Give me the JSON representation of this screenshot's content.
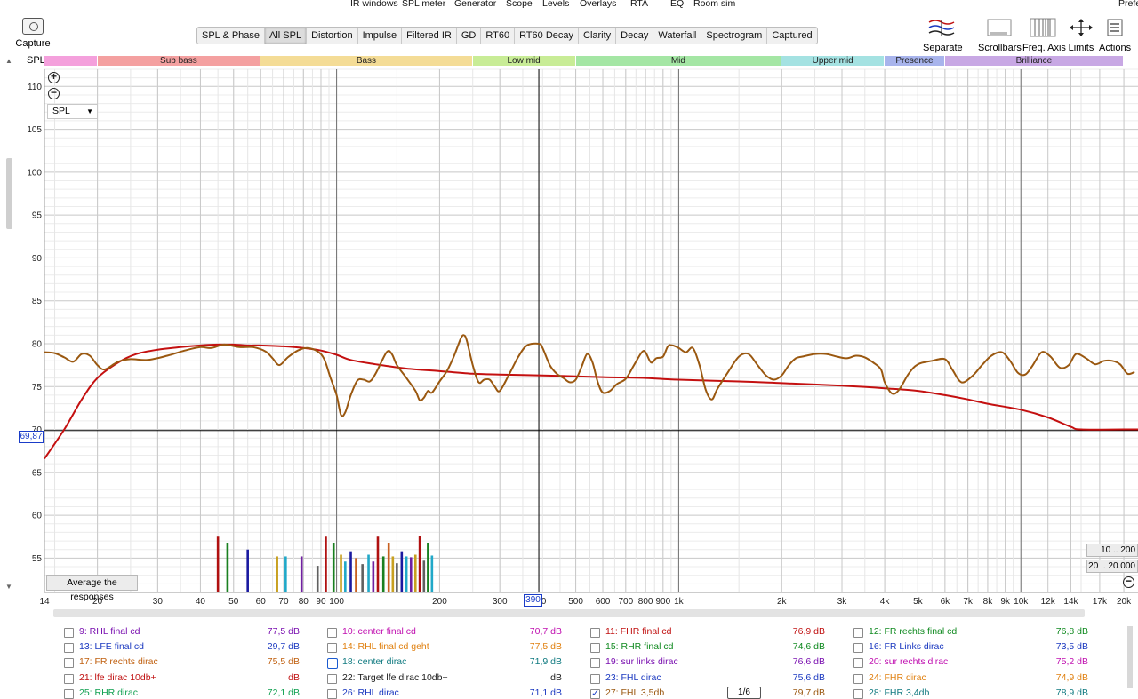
{
  "menu": [
    "IR windows",
    "SPL meter",
    "Generator",
    "Scope",
    "Levels",
    "Overlays",
    "RTA",
    "EQ",
    "Room sim",
    "Prefe"
  ],
  "capture_label": "Capture",
  "tabs": [
    "SPL & Phase",
    "All SPL",
    "Distortion",
    "Impulse",
    "Filtered IR",
    "GD",
    "RT60",
    "RT60 Decay",
    "Clarity",
    "Decay",
    "Waterfall",
    "Spectrogram",
    "Captured"
  ],
  "active_tab": "All SPL",
  "tools": [
    "Separate",
    "Scrollbars",
    "Freq. Axis",
    "Limits",
    "Actions"
  ],
  "plot_header": "SPL",
  "bands": [
    {
      "label": "",
      "color": "#f4a0dc",
      "f1": 14,
      "f2": 20
    },
    {
      "label": "Sub bass",
      "color": "#f4a0a0",
      "f1": 20,
      "f2": 60
    },
    {
      "label": "Bass",
      "color": "#f4dc96",
      "f1": 60,
      "f2": 250
    },
    {
      "label": "Low mid",
      "color": "#c8ec96",
      "f1": 250,
      "f2": 500
    },
    {
      "label": "Mid",
      "color": "#a4e6a4",
      "f1": 500,
      "f2": 2000
    },
    {
      "label": "Upper mid",
      "color": "#a4e2e2",
      "f1": 2000,
      "f2": 4000
    },
    {
      "label": "Presence",
      "color": "#a8b4ec",
      "f1": 4000,
      "f2": 6000
    },
    {
      "label": "Brilliance",
      "color": "#c8a8e4",
      "f1": 6000,
      "f2": 20000
    }
  ],
  "y_select": "SPL",
  "cursor_y": "69,87",
  "cursor_x": "390",
  "avg_button": "Average the responses",
  "range_buttons": [
    "10 .. 200",
    "20 .. 20.000"
  ],
  "chart_data": {
    "type": "line",
    "xscale": "log",
    "xlim": [
      14,
      22000
    ],
    "ylim": [
      51,
      112
    ],
    "yticks": [
      55,
      60,
      65,
      70,
      75,
      80,
      85,
      90,
      95,
      100,
      105,
      110
    ],
    "xticks": [
      {
        "f": 14,
        "label": "14"
      },
      {
        "f": 20,
        "label": "20"
      },
      {
        "f": 30,
        "label": "30"
      },
      {
        "f": 40,
        "label": "40"
      },
      {
        "f": 50,
        "label": "50"
      },
      {
        "f": 60,
        "label": "60"
      },
      {
        "f": 70,
        "label": "70"
      },
      {
        "f": 80,
        "label": "80"
      },
      {
        "f": 90,
        "label": "90"
      },
      {
        "f": 100,
        "label": "100"
      },
      {
        "f": 200,
        "label": "200"
      },
      {
        "f": 300,
        "label": "300"
      },
      {
        "f": 390,
        "label": "390"
      },
      {
        "f": 500,
        "label": "500"
      },
      {
        "f": 600,
        "label": "600"
      },
      {
        "f": 700,
        "label": "700"
      },
      {
        "f": 800,
        "label": "800"
      },
      {
        "f": 900,
        "label": "900"
      },
      {
        "f": 1000,
        "label": "1k"
      },
      {
        "f": 2000,
        "label": "2k"
      },
      {
        "f": 3000,
        "label": "3k"
      },
      {
        "f": 4000,
        "label": "4k"
      },
      {
        "f": 5000,
        "label": "5k"
      },
      {
        "f": 6000,
        "label": "6k"
      },
      {
        "f": 7000,
        "label": "7k"
      },
      {
        "f": 8000,
        "label": "8k"
      },
      {
        "f": 9000,
        "label": "9k"
      },
      {
        "f": 10000,
        "label": "10k"
      },
      {
        "f": 12000,
        "label": "12k"
      },
      {
        "f": 14000,
        "label": "14k"
      },
      {
        "f": 17000,
        "label": "17k"
      },
      {
        "f": 20000,
        "label": "20k"
      }
    ],
    "series": [
      {
        "color": "#c41010",
        "points": [
          [
            14,
            66.6
          ],
          [
            16,
            70
          ],
          [
            18,
            73.5
          ],
          [
            20,
            76
          ],
          [
            23,
            77.8
          ],
          [
            26,
            78.8
          ],
          [
            30,
            79.3
          ],
          [
            35,
            79.6
          ],
          [
            40,
            79.8
          ],
          [
            45,
            79.9
          ],
          [
            50,
            79.9
          ],
          [
            55,
            79.8
          ],
          [
            60,
            79.8
          ],
          [
            70,
            79.7
          ],
          [
            80,
            79.5
          ],
          [
            90,
            79.2
          ],
          [
            100,
            78.7
          ],
          [
            110,
            78.1
          ],
          [
            130,
            77.6
          ],
          [
            160,
            77.1
          ],
          [
            200,
            76.8
          ],
          [
            250,
            76.5
          ],
          [
            300,
            76.4
          ],
          [
            400,
            76.3
          ],
          [
            500,
            76.2
          ],
          [
            600,
            76.1
          ],
          [
            800,
            76
          ],
          [
            1000,
            75.8
          ],
          [
            1500,
            75.6
          ],
          [
            2000,
            75.4
          ],
          [
            3000,
            75.1
          ],
          [
            4000,
            74.8
          ],
          [
            5000,
            74.5
          ],
          [
            6000,
            74
          ],
          [
            7000,
            73.5
          ],
          [
            8000,
            73
          ],
          [
            10000,
            72.3
          ],
          [
            12000,
            71.4
          ],
          [
            14000,
            70.3
          ],
          [
            15000,
            70
          ],
          [
            20000,
            70
          ],
          [
            22000,
            70
          ]
        ]
      },
      {
        "color": "#9a5810",
        "points": [
          [
            14,
            79
          ],
          [
            15,
            78.9
          ],
          [
            16,
            78.4
          ],
          [
            17,
            77.9
          ],
          [
            18,
            78.8
          ],
          [
            19,
            78.6
          ],
          [
            20,
            77.5
          ],
          [
            21,
            77
          ],
          [
            23,
            77.9
          ],
          [
            25,
            78.2
          ],
          [
            28,
            78.1
          ],
          [
            32,
            78.6
          ],
          [
            36,
            79.2
          ],
          [
            40,
            79.6
          ],
          [
            43,
            79.5
          ],
          [
            47,
            79.9
          ],
          [
            52,
            79.6
          ],
          [
            57,
            79.6
          ],
          [
            62,
            79.1
          ],
          [
            65,
            78.3
          ],
          [
            68,
            77.5
          ],
          [
            72,
            78.4
          ],
          [
            77,
            79.2
          ],
          [
            82,
            79.5
          ],
          [
            88,
            79.1
          ],
          [
            92,
            78.2
          ],
          [
            96,
            76
          ],
          [
            100,
            74
          ],
          [
            103,
            71.7
          ],
          [
            106,
            72
          ],
          [
            110,
            74
          ],
          [
            115,
            75.7
          ],
          [
            120,
            75.8
          ],
          [
            125,
            75.6
          ],
          [
            130,
            76.5
          ],
          [
            140,
            79
          ],
          [
            145,
            78.8
          ],
          [
            150,
            77.5
          ],
          [
            160,
            76
          ],
          [
            170,
            74.5
          ],
          [
            175,
            73.4
          ],
          [
            180,
            73.7
          ],
          [
            185,
            74.5
          ],
          [
            190,
            74.3
          ],
          [
            200,
            75.6
          ],
          [
            210,
            76.8
          ],
          [
            220,
            78.5
          ],
          [
            230,
            80.5
          ],
          [
            235,
            81
          ],
          [
            240,
            80.4
          ],
          [
            250,
            77.5
          ],
          [
            260,
            75.5
          ],
          [
            270,
            75.8
          ],
          [
            280,
            75.8
          ],
          [
            290,
            75
          ],
          [
            300,
            74.5
          ],
          [
            320,
            76.5
          ],
          [
            340,
            78.5
          ],
          [
            360,
            79.8
          ],
          [
            390,
            80
          ],
          [
            400,
            79.5
          ],
          [
            420,
            77.5
          ],
          [
            440,
            76.5
          ],
          [
            460,
            76
          ],
          [
            480,
            75.5
          ],
          [
            500,
            75.8
          ],
          [
            520,
            77.3
          ],
          [
            540,
            78.8
          ],
          [
            560,
            77.8
          ],
          [
            580,
            75.5
          ],
          [
            600,
            74.3
          ],
          [
            630,
            74.5
          ],
          [
            660,
            75.3
          ],
          [
            700,
            75.9
          ],
          [
            740,
            77.5
          ],
          [
            780,
            79
          ],
          [
            800,
            79
          ],
          [
            830,
            77.8
          ],
          [
            860,
            78.3
          ],
          [
            900,
            78.5
          ],
          [
            930,
            79.7
          ],
          [
            960,
            79.8
          ],
          [
            1000,
            79.5
          ],
          [
            1050,
            79
          ],
          [
            1100,
            79.5
          ],
          [
            1150,
            77.5
          ],
          [
            1200,
            74.6
          ],
          [
            1250,
            73.5
          ],
          [
            1300,
            74.8
          ],
          [
            1400,
            76.8
          ],
          [
            1500,
            78.5
          ],
          [
            1600,
            78.8
          ],
          [
            1700,
            77.5
          ],
          [
            1800,
            76.3
          ],
          [
            1900,
            75.8
          ],
          [
            2000,
            76.3
          ],
          [
            2100,
            77.5
          ],
          [
            2200,
            78.3
          ],
          [
            2300,
            78.5
          ],
          [
            2500,
            78.8
          ],
          [
            2700,
            78.8
          ],
          [
            2900,
            78.5
          ],
          [
            3100,
            78.3
          ],
          [
            3300,
            78.6
          ],
          [
            3500,
            78.4
          ],
          [
            3700,
            77.8
          ],
          [
            3900,
            77
          ],
          [
            4000,
            75.5
          ],
          [
            4200,
            74.2
          ],
          [
            4400,
            74.6
          ],
          [
            4700,
            76.5
          ],
          [
            5000,
            77.6
          ],
          [
            5500,
            78
          ],
          [
            6000,
            78.2
          ],
          [
            6300,
            77
          ],
          [
            6700,
            75.5
          ],
          [
            7200,
            76.2
          ],
          [
            7700,
            77.5
          ],
          [
            8200,
            78.6
          ],
          [
            8800,
            79
          ],
          [
            9300,
            78
          ],
          [
            9800,
            76.6
          ],
          [
            10300,
            76.4
          ],
          [
            10800,
            77.4
          ],
          [
            11500,
            79
          ],
          [
            12200,
            78.5
          ],
          [
            13000,
            77.2
          ],
          [
            13800,
            77.5
          ],
          [
            14500,
            78.8
          ],
          [
            15500,
            78.3
          ],
          [
            16500,
            77.6
          ],
          [
            17500,
            78
          ],
          [
            18500,
            78
          ],
          [
            19500,
            77.6
          ],
          [
            20500,
            76.5
          ],
          [
            21500,
            76.7
          ]
        ]
      }
    ],
    "bars": [
      {
        "f": 45,
        "v": 57.5,
        "color": "#b01010"
      },
      {
        "f": 48,
        "v": 56.8,
        "color": "#1a8020"
      },
      {
        "f": 55,
        "v": 56,
        "color": "#1a1aa0"
      },
      {
        "f": 67,
        "v": 55.2,
        "color": "#c8a020"
      },
      {
        "f": 71,
        "v": 55.2,
        "color": "#20a8c8"
      },
      {
        "f": 79,
        "v": 55.2,
        "color": "#7020a0"
      },
      {
        "f": 88,
        "v": 54.1,
        "color": "#606060"
      },
      {
        "f": 93,
        "v": 57.5,
        "color": "#b01010"
      },
      {
        "f": 98,
        "v": 56.8,
        "color": "#1a8020"
      },
      {
        "f": 103,
        "v": 55.4,
        "color": "#c8a020"
      },
      {
        "f": 106,
        "v": 54.6,
        "color": "#20a8c8"
      },
      {
        "f": 110,
        "v": 55.8,
        "color": "#1a1aa0"
      },
      {
        "f": 114,
        "v": 55,
        "color": "#c86020"
      },
      {
        "f": 119,
        "v": 54.3,
        "color": "#606060"
      },
      {
        "f": 124,
        "v": 55.4,
        "color": "#20a8c8"
      },
      {
        "f": 128,
        "v": 54.6,
        "color": "#7020a0"
      },
      {
        "f": 132,
        "v": 57.5,
        "color": "#b01010"
      },
      {
        "f": 137,
        "v": 55.2,
        "color": "#1a8020"
      },
      {
        "f": 142,
        "v": 56.8,
        "color": "#c86020"
      },
      {
        "f": 146,
        "v": 55.2,
        "color": "#c8a020"
      },
      {
        "f": 150,
        "v": 54.4,
        "color": "#606060"
      },
      {
        "f": 155,
        "v": 55.8,
        "color": "#1a1aa0"
      },
      {
        "f": 160,
        "v": 55.2,
        "color": "#20a8c8"
      },
      {
        "f": 165,
        "v": 55.1,
        "color": "#7020a0"
      },
      {
        "f": 170,
        "v": 55.4,
        "color": "#c8a020"
      },
      {
        "f": 175,
        "v": 57.6,
        "color": "#b01010"
      },
      {
        "f": 180,
        "v": 54.7,
        "color": "#606060"
      },
      {
        "f": 185,
        "v": 56.8,
        "color": "#1a8020"
      },
      {
        "f": 190,
        "v": 55.3,
        "color": "#20a8c8"
      }
    ]
  },
  "measurements": [
    [
      {
        "name": "9: RHL final cd",
        "value": "77,5 dB",
        "color": "#7a10b0",
        "checked": false
      },
      {
        "name": "13: LFE final cd",
        "value": "29,7 dB",
        "color": "#1a38c0",
        "checked": false
      },
      {
        "name": "17: FR rechts dirac",
        "value": "75,5 dB",
        "color": "#c06010",
        "checked": false
      },
      {
        "name": "21: lfe dirac  10db+",
        "value": "dB",
        "color": "#c01010",
        "checked": false
      },
      {
        "name": "25: RHR dirac",
        "value": "72,1 dB",
        "color": "#10a050",
        "checked": false
      }
    ],
    [
      {
        "name": "10: center final cd",
        "value": "70,7 dB",
        "color": "#c010b0",
        "checked": false
      },
      {
        "name": "14: RHL final cd geht",
        "value": "77,5 dB",
        "color": "#e08010",
        "checked": false
      },
      {
        "name": "18: center dirac",
        "value": "71,9 dB",
        "color": "#107a80",
        "checked": false,
        "selected": true
      },
      {
        "name": "22: Target lfe dirac  10db+",
        "value": "dB",
        "color": "#202020",
        "checked": false
      },
      {
        "name": "26: RHL dirac",
        "value": "71,1 dB",
        "color": "#1a38c0",
        "checked": false
      }
    ],
    [
      {
        "name": "11: FHR final cd",
        "value": "76,9 dB",
        "color": "#c01010",
        "checked": false
      },
      {
        "name": "15: RHR final cd",
        "value": "74,6 dB",
        "color": "#108a20",
        "checked": false
      },
      {
        "name": "19: sur links dirac",
        "value": "76,6 dB",
        "color": "#7a10b0",
        "checked": false
      },
      {
        "name": "23: FHL dirac",
        "value": "75,6 dB",
        "color": "#1a38c0",
        "checked": false
      },
      {
        "name": "27: FHL 3,5db",
        "value": "79,7 dB",
        "color": "#9a5810",
        "checked": true
      }
    ],
    [
      {
        "name": "12: FR rechts final cd",
        "value": "76,8 dB",
        "color": "#108a20",
        "checked": false
      },
      {
        "name": "16: FR Links dirac",
        "value": "73,5 dB",
        "color": "#1a38c0",
        "checked": false
      },
      {
        "name": "20: sur rechts dirac",
        "value": "75,2 dB",
        "color": "#c010b0",
        "checked": false
      },
      {
        "name": "24: FHR dirac",
        "value": "74,9 dB",
        "color": "#e08010",
        "checked": false
      },
      {
        "name": "28: FHR 3,4db",
        "value": "78,9 dB",
        "color": "#107a80",
        "checked": false
      }
    ]
  ],
  "smoothing_label": "1/6"
}
